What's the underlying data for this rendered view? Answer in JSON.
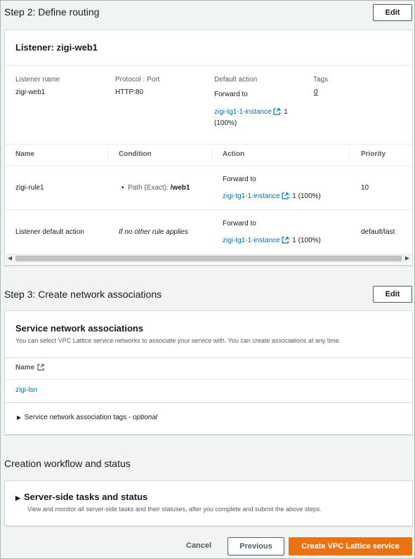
{
  "step2": {
    "title": "Step 2: Define routing",
    "edit_label": "Edit",
    "listener_title": "Listener: zigi-web1",
    "details": {
      "name_label": "Listener name",
      "name_value": "zigi-web1",
      "protocol_label": "Protocol : Port",
      "protocol_value": "HTTP:80",
      "default_action_label": "Default action",
      "default_action_prefix": "Forward to",
      "default_action_target": "zigi-tg1-1-instance",
      "default_action_weight": ": 1",
      "default_action_percent": "(100%)",
      "tags_label": "Tags",
      "tags_value": "0"
    },
    "table": {
      "headers": [
        "Name",
        "Condition",
        "Action",
        "Priority"
      ],
      "rows": [
        {
          "name": "zigi-rule1",
          "condition_label": "Path (Exact):",
          "condition_value": "/web1",
          "action_prefix": "Forward to",
          "action_target": "zigi-tg1-1-instance",
          "action_weight": ": 1 (100%)",
          "priority": "10"
        },
        {
          "name": "Listener default action",
          "condition_text": "If no other rule applies",
          "action_prefix": "Forward to",
          "action_target": "zigi-tg1-1-instance",
          "action_weight": ": 1 (100%)",
          "priority": "default/last"
        }
      ]
    }
  },
  "step3": {
    "title": "Step 3: Create network associations",
    "edit_label": "Edit",
    "panel_title": "Service network associations",
    "panel_desc": "You can select VPC Lattice service networks to associate your service with. You can create associations at any time.",
    "column_name": "Name",
    "association": "zigi-lsn",
    "tags_toggle": "Service network association tags -",
    "tags_optional": "optional"
  },
  "workflow": {
    "title": "Creation workflow and status",
    "panel_title": "Server-side tasks and status",
    "panel_desc": "View and monitor all server-side tasks and their statuses, after you complete and submit the above steps."
  },
  "footer": {
    "cancel": "Cancel",
    "previous": "Previous",
    "create": "Create VPC Lattice service"
  },
  "colors": {
    "link": "#0073bb",
    "primary": "#ec7211"
  }
}
